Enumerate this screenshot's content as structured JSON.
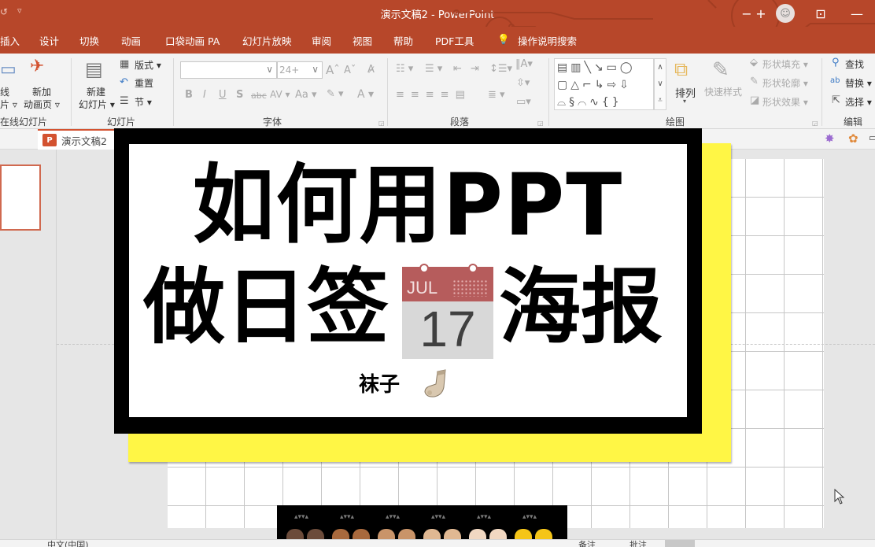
{
  "window": {
    "title": "演示文稿2  -  PowerPoint",
    "quick_access": [
      "undo-icon",
      "customize-qa-icon"
    ],
    "controls": [
      "minus-icon",
      "plus-icon",
      "account-avatar",
      "ribbon-display-icon",
      "minimize-icon"
    ]
  },
  "ribbon_tabs": [
    {
      "label": "插入"
    },
    {
      "label": "设计"
    },
    {
      "label": "切换"
    },
    {
      "label": "动画"
    },
    {
      "label": "口袋动画 PA"
    },
    {
      "label": "幻灯片放映"
    },
    {
      "label": "审阅"
    },
    {
      "label": "视图"
    },
    {
      "label": "帮助"
    },
    {
      "label": "PDF工具"
    },
    {
      "label": "操作说明搜索"
    }
  ],
  "ribbon": {
    "online": {
      "btn1": "线",
      "btn1b": "片 ▿",
      "btn2": "新加",
      "btn2b": "动画页 ▿",
      "label": "在线幻灯片"
    },
    "slides": {
      "new_slide": "新建",
      "new_slide_b": "幻灯片 ▾",
      "layout": "版式 ▾",
      "reset": "重置",
      "section": "节 ▾",
      "label": "幻灯片"
    },
    "font": {
      "font_name": "",
      "font_size": "24+",
      "label": "字体",
      "buttons": [
        "B",
        "I",
        "U",
        "S",
        "abc",
        "AV ▾",
        "Aa ▾",
        "A ▾"
      ]
    },
    "paragraph": {
      "label": "段落"
    },
    "drawing": {
      "arrange": "排列",
      "quick_styles": "快速样式",
      "shape_fill": "形状填充 ▾",
      "shape_outline": "形状轮廓 ▾",
      "shape_effects": "形状效果 ▾",
      "label": "绘图"
    },
    "editing": {
      "find": "查找",
      "replace": "替换 ▾",
      "select": "选择 ▾",
      "label": "编辑"
    }
  },
  "doc_tab": {
    "label": "演示文稿2",
    "icon": "P"
  },
  "slide": {
    "line1": "如何用PPT",
    "line2a": "做日签",
    "line2b": "海报",
    "calendar": {
      "month": "JUL",
      "day": "17"
    },
    "author": "袜子",
    "colors": {
      "frame": "#000000",
      "shadow": "#fff645",
      "calendar_top": "#b65c5c"
    }
  },
  "statusbar": {
    "left_text": "中文(中国)",
    "notes": "备注",
    "comments": "批注"
  },
  "overlay": {
    "hand_colors": [
      "#6b4b3a",
      "#a8693d",
      "#c99469",
      "#e0b892",
      "#f1d8c2",
      "#f5c518"
    ]
  }
}
